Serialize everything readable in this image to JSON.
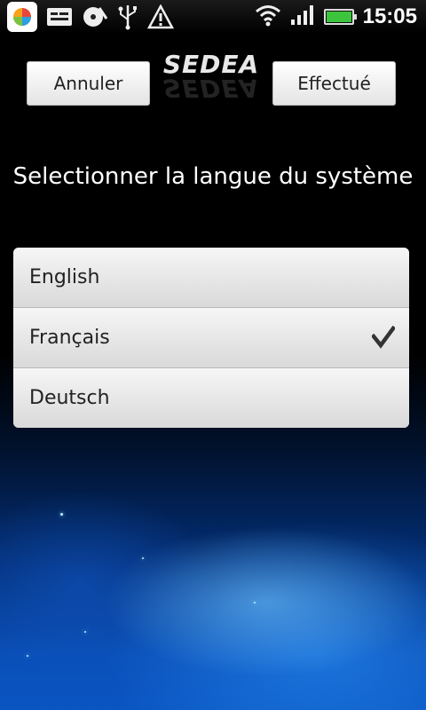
{
  "status_bar": {
    "time": "15:05",
    "icons": [
      "app-store-icon",
      "sms-icon",
      "disk-icon",
      "usb-icon",
      "warning-icon",
      "wifi-icon",
      "signal-icon",
      "battery-icon"
    ],
    "battery_level": 1.0
  },
  "header": {
    "cancel_label": "Annuler",
    "done_label": "Effectué",
    "logo_text": "SEDEA"
  },
  "title": "Selectionner la langue du système",
  "languages": [
    {
      "label": "English",
      "selected": false
    },
    {
      "label": "Français",
      "selected": true
    },
    {
      "label": "Deutsch",
      "selected": false
    }
  ],
  "colors": {
    "check": "#333333",
    "battery": "#3cc43c"
  }
}
